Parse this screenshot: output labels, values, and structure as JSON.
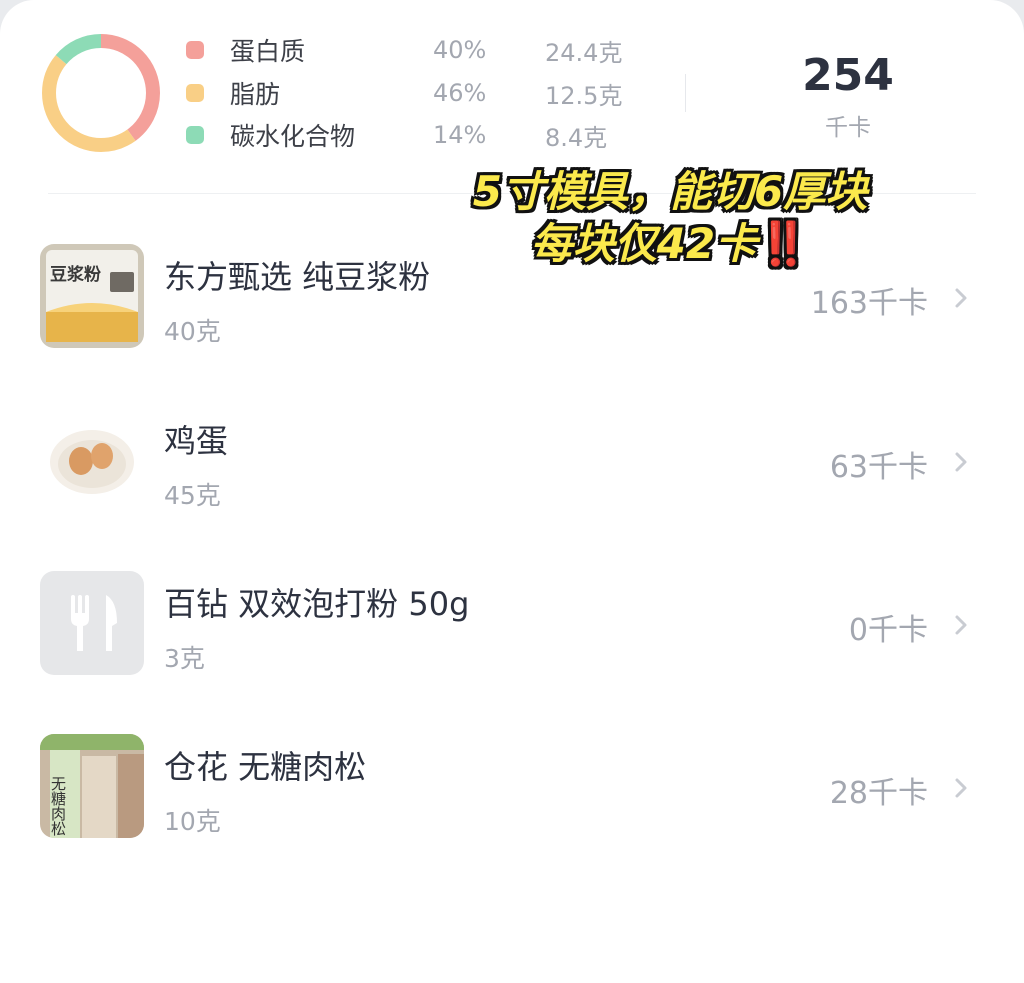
{
  "summary": {
    "macros": [
      {
        "name": "蛋白质",
        "percent": "40%",
        "grams": "24.4克",
        "color": "#f4a09a"
      },
      {
        "name": "脂肪",
        "percent": "46%",
        "grams": "12.5克",
        "color": "#f9cf86"
      },
      {
        "name": "碳水化合物",
        "percent": "14%",
        "grams": "8.4克",
        "color": "#8ddbb6"
      }
    ],
    "total_kcal": "254",
    "kcal_unit": "千卡"
  },
  "overlay": {
    "line1": "5寸模具，能切6厚块",
    "line2": "每块仅42卡",
    "emphasis": "‼️"
  },
  "foods": [
    {
      "name": "东方甄选 纯豆浆粉",
      "amount": "40克",
      "kcal": "163千卡",
      "thumb": "soy-milk-powder-bag"
    },
    {
      "name": "鸡蛋",
      "amount": "45克",
      "kcal": "63千卡",
      "thumb": "eggs-on-plate"
    },
    {
      "name": "百钻 双效泡打粉 50g",
      "amount": "3克",
      "kcal": "0千卡",
      "thumb": "fork-knife-placeholder-icon"
    },
    {
      "name": "仓花 无糖肉松",
      "amount": "10克",
      "kcal": "28千卡",
      "thumb": "meat-floss-bag"
    }
  ],
  "thumb_texts": {
    "soy": "豆浆粉",
    "floss": "无糖肉松"
  },
  "colors": {
    "protein": "#f4a09a",
    "fat": "#f9cf86",
    "carbs": "#8ddbb6",
    "muted_text": "#a3a7b0",
    "primary_text": "#2d3240"
  }
}
